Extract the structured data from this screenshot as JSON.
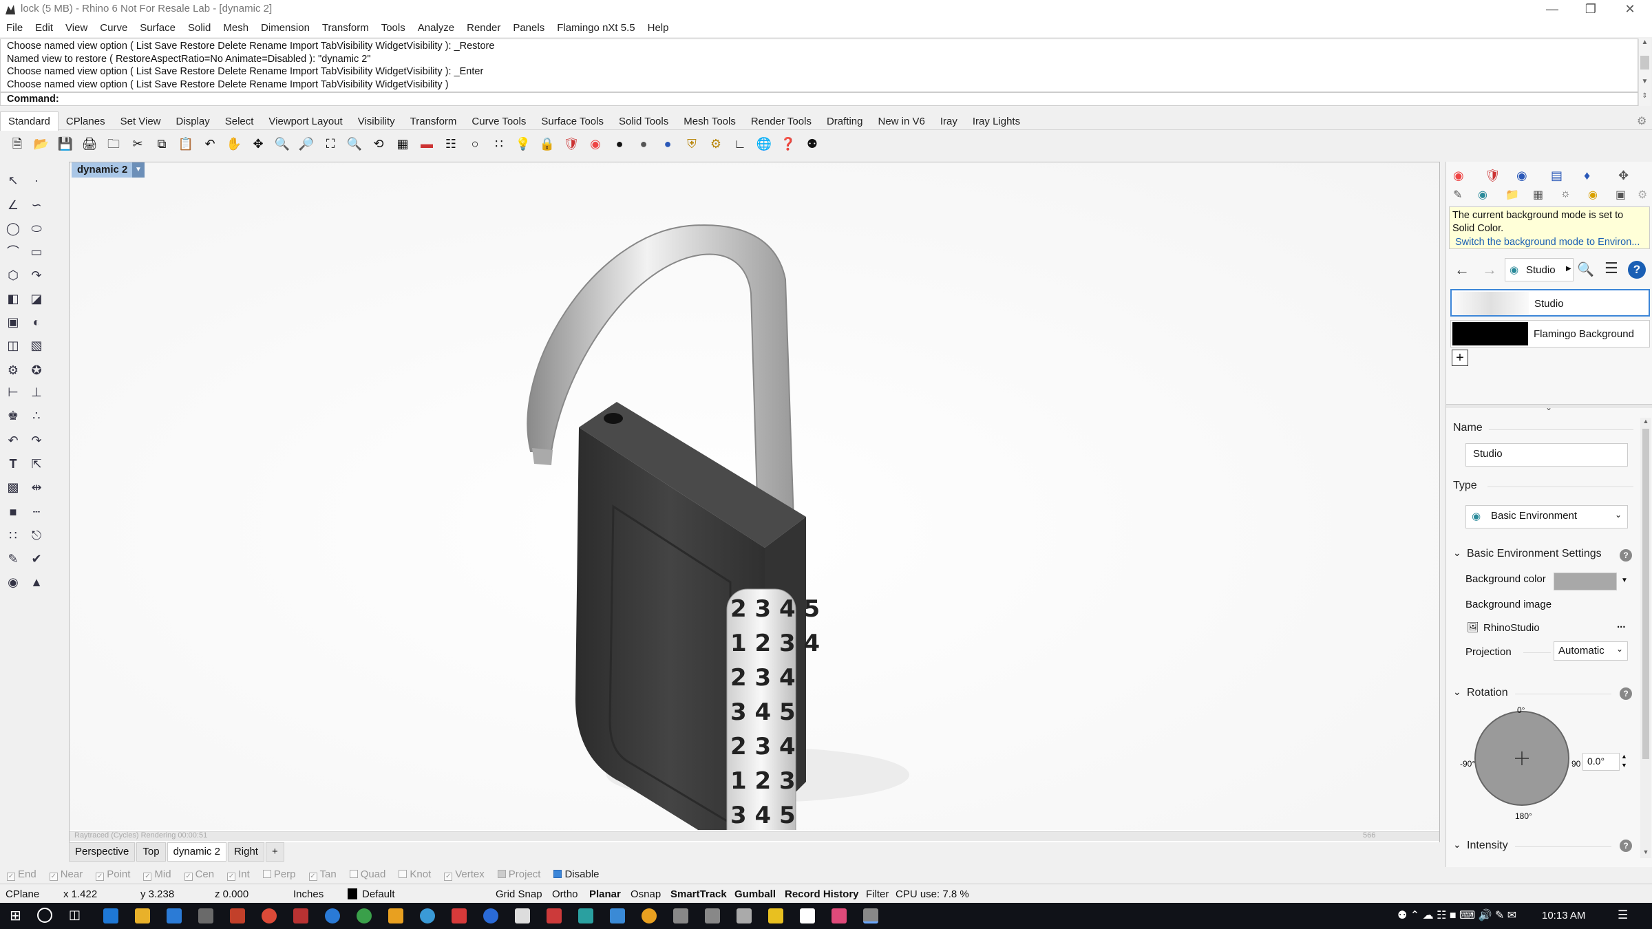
{
  "window": {
    "title": "lock (5 MB) - Rhino 6 Not For Resale Lab - [dynamic 2]"
  },
  "menu": [
    "File",
    "Edit",
    "View",
    "Curve",
    "Surface",
    "Solid",
    "Mesh",
    "Dimension",
    "Transform",
    "Tools",
    "Analyze",
    "Render",
    "Panels",
    "Flamingo nXt 5.5",
    "Help"
  ],
  "command": {
    "history": [
      "Choose named view option ( List  Save  Restore  Delete  Rename  Import  TabVisibility  WidgetVisibility ): _Restore",
      "Named view to restore ( RestoreAspectRatio=No  Animate=Disabled ): \"dynamic 2\"",
      "Choose named view option ( List  Save  Restore  Delete  Rename  Import  TabVisibility  WidgetVisibility ): _Enter",
      "Choose named view option ( List  Save  Restore  Delete  Rename  Import  TabVisibility  WidgetVisibility )"
    ],
    "prompt_label": "Command:"
  },
  "toolbar_tabs": [
    "Standard",
    "CPlanes",
    "Set View",
    "Display",
    "Select",
    "Viewport Layout",
    "Visibility",
    "Transform",
    "Curve Tools",
    "Surface Tools",
    "Solid Tools",
    "Mesh Tools",
    "Render Tools",
    "Drafting",
    "New in V6",
    "Iray",
    "Iray Lights"
  ],
  "viewport": {
    "title": "dynamic 2",
    "render_status": "Raytraced (Cycles)   Rendering      00:00:51",
    "render_passes": "566",
    "tabs": [
      "Perspective",
      "Top",
      "dynamic 2",
      "Right"
    ],
    "add_tab": "+"
  },
  "osnaps": [
    {
      "label": "End",
      "checked": true
    },
    {
      "label": "Near",
      "checked": true
    },
    {
      "label": "Point",
      "checked": true
    },
    {
      "label": "Mid",
      "checked": true
    },
    {
      "label": "Cen",
      "checked": true
    },
    {
      "label": "Int",
      "checked": true
    },
    {
      "label": "Perp",
      "checked": false
    },
    {
      "label": "Tan",
      "checked": true
    },
    {
      "label": "Quad",
      "checked": false
    },
    {
      "label": "Knot",
      "checked": false
    },
    {
      "label": "Vertex",
      "checked": true
    },
    {
      "label": "Project",
      "checked": false
    }
  ],
  "osnap_disable": "Disable",
  "statusbar": {
    "cplane": "CPlane",
    "x": "x 1.422",
    "y": "y 3.238",
    "z": "z 0.000",
    "units": "Inches",
    "layer": "Default",
    "grid_snap": "Grid Snap",
    "ortho": "Ortho",
    "planar": "Planar",
    "osnap": "Osnap",
    "smarttrack": "SmartTrack",
    "gumball": "Gumball",
    "record_history": "Record History",
    "filter": "Filter",
    "cpu": "CPU use: 7.8 %"
  },
  "panel": {
    "info_text": "The current background mode is set to Solid Color.",
    "info_link": "Switch the background mode to Environ...",
    "breadcrumb": "Studio",
    "environments": [
      {
        "name": "Studio",
        "swatch": "#e8e8e8"
      },
      {
        "name": "Flamingo Background",
        "swatch": "#000000"
      }
    ],
    "add_label": "+",
    "name_label": "Name",
    "name_value": "Studio",
    "type_label": "Type",
    "type_value": "Basic Environment",
    "settings_title": "Basic Environment Settings",
    "bg_color_label": "Background color",
    "bg_color_value": "#a8a8a8",
    "bg_image_label": "Background image",
    "bg_image_value": "RhinoStudio",
    "bg_image_more": "...",
    "projection_label": "Projection",
    "projection_value": "Automatic",
    "rotation_title": "Rotation",
    "rotation_top": "0°",
    "rotation_bottom": "180°",
    "rotation_left": "-90°",
    "rotation_right": "90",
    "rotation_value": "0.0°",
    "intensity_title": "Intensity"
  },
  "taskbar": {
    "time": "10:13 AM"
  },
  "colors": {
    "accent": "#3c86d8",
    "viewport_title_bg": "#a9c6e6",
    "lock_body": "#3a3a3a",
    "shackle": "#c8c8c8"
  }
}
